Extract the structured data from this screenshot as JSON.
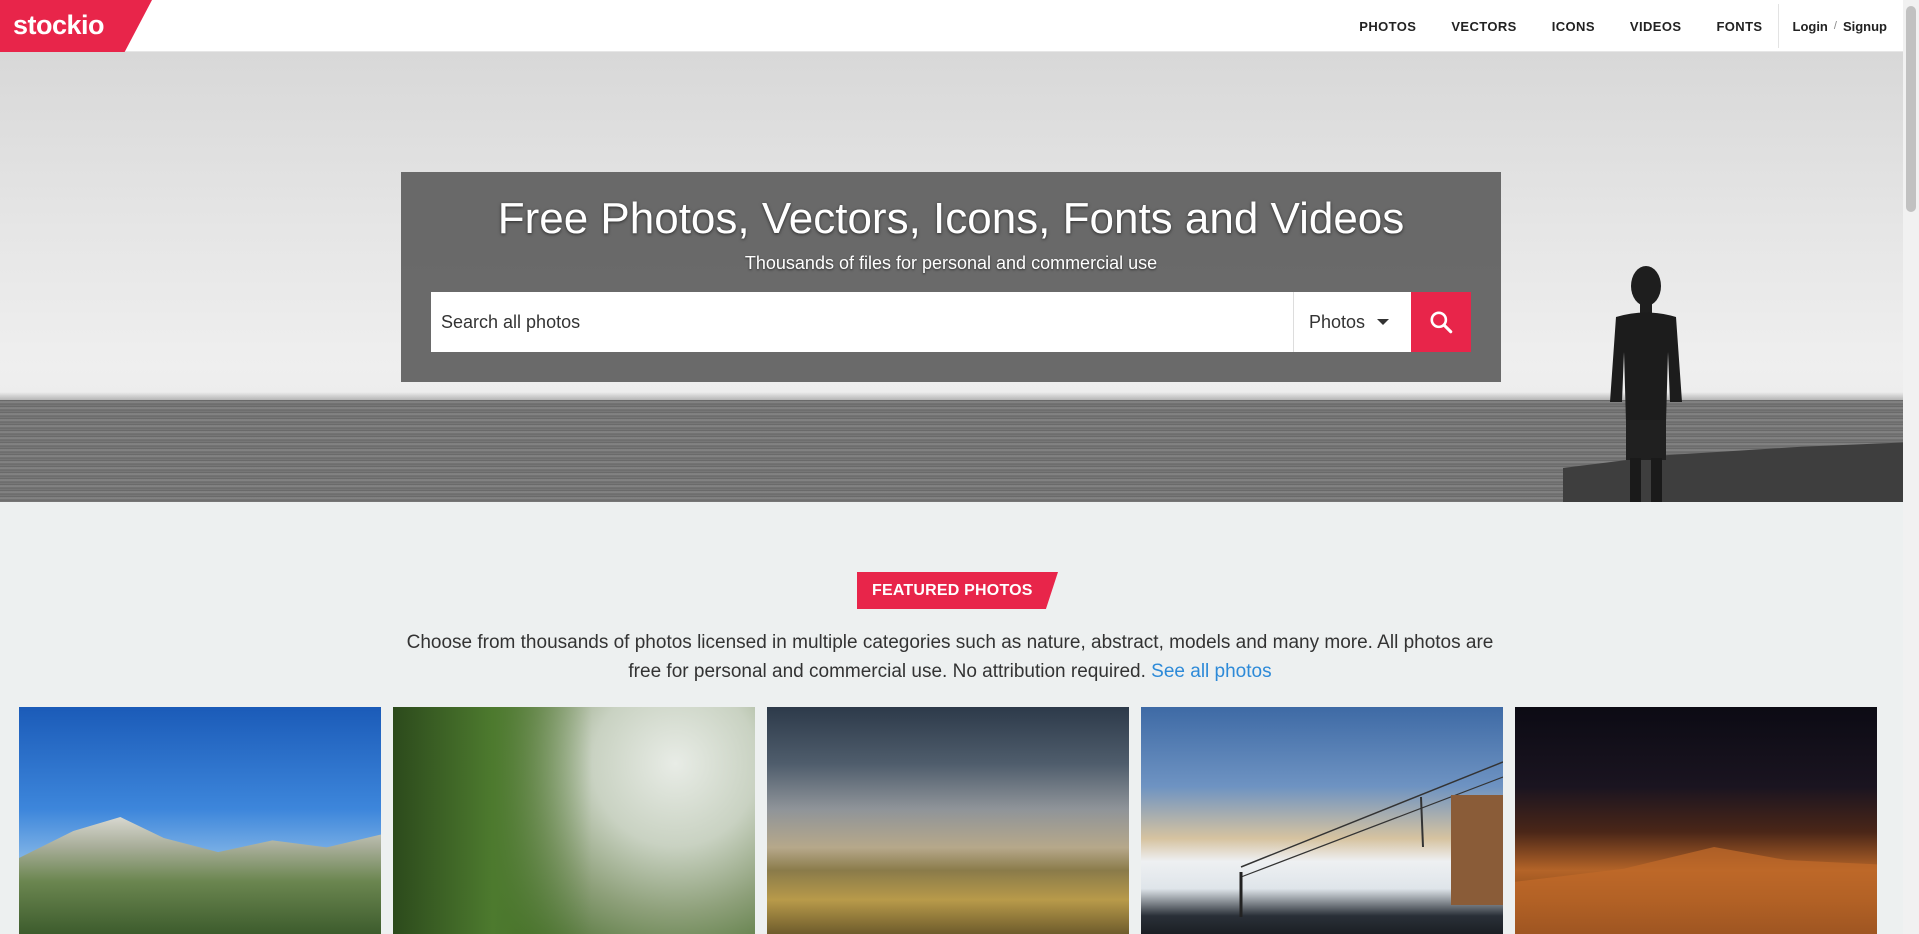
{
  "brand": {
    "logo_text": "stockio",
    "accent_color": "#e8254a"
  },
  "nav": {
    "links": [
      "PHOTOS",
      "VECTORS",
      "ICONS",
      "VIDEOS",
      "FONTS"
    ],
    "login": "Login",
    "separator": "/",
    "signup": "Signup"
  },
  "hero": {
    "title": "Free Photos, Vectors, Icons, Fonts and Videos",
    "subtitle": "Thousands of files for personal and commercial use",
    "search_placeholder": "Search all photos",
    "search_type": "Photos",
    "search_icon": "search-icon"
  },
  "featured": {
    "badge": "FEATURED PHOTOS",
    "description": "Choose from thousands of photos licensed in multiple categories such as nature, abstract, models and many more. All photos are free for personal and commercial use. No attribution required.",
    "link_text": "See all photos",
    "link_color": "#2d8ad8"
  }
}
